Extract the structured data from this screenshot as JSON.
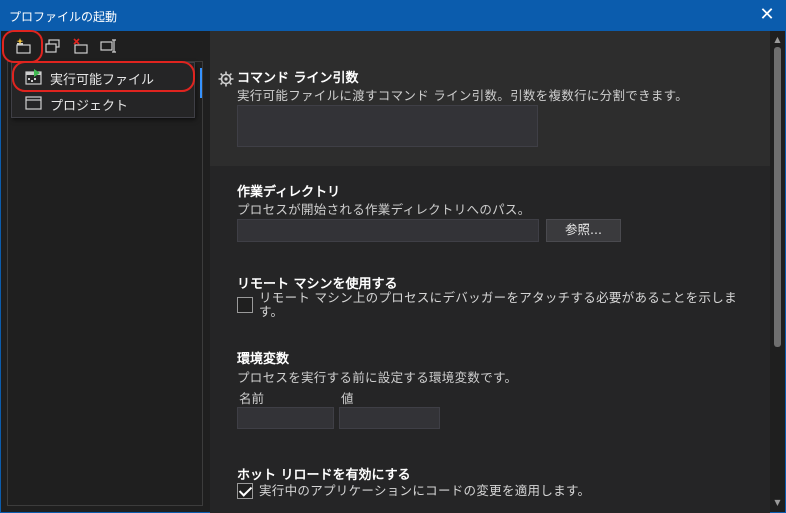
{
  "window": {
    "title": "プロファイルの起動",
    "close_glyph": "✕"
  },
  "menu": {
    "items": [
      {
        "label": "実行可能ファイル"
      },
      {
        "label": "プロジェクト"
      }
    ]
  },
  "sections": {
    "command_line": {
      "title": "コマンド ライン引数",
      "description": "実行可能ファイルに渡すコマンド ライン引数。引数を複数行に分割できます。",
      "value": ""
    },
    "working_dir": {
      "title": "作業ディレクトリ",
      "description": "プロセスが開始される作業ディレクトリへのパス。",
      "value": "",
      "browse_label": "参照..."
    },
    "remote": {
      "title": "リモート マシンを使用する",
      "checkbox_label": "リモート マシン上のプロセスにデバッガーをアタッチする必要があることを示します。",
      "checked": false
    },
    "env": {
      "title": "環境変数",
      "description": "プロセスを実行する前に設定する環境変数です。",
      "name_header": "名前",
      "value_header": "値"
    },
    "hot_reload": {
      "title": "ホット リロードを有効にする",
      "checkbox_label": "実行中のアプリケーションにコードの変更を適用します。",
      "checked": true
    }
  },
  "colors": {
    "titlebar": "#0b5cad",
    "annotation": "#e0241f",
    "accent": "#3794ff"
  }
}
